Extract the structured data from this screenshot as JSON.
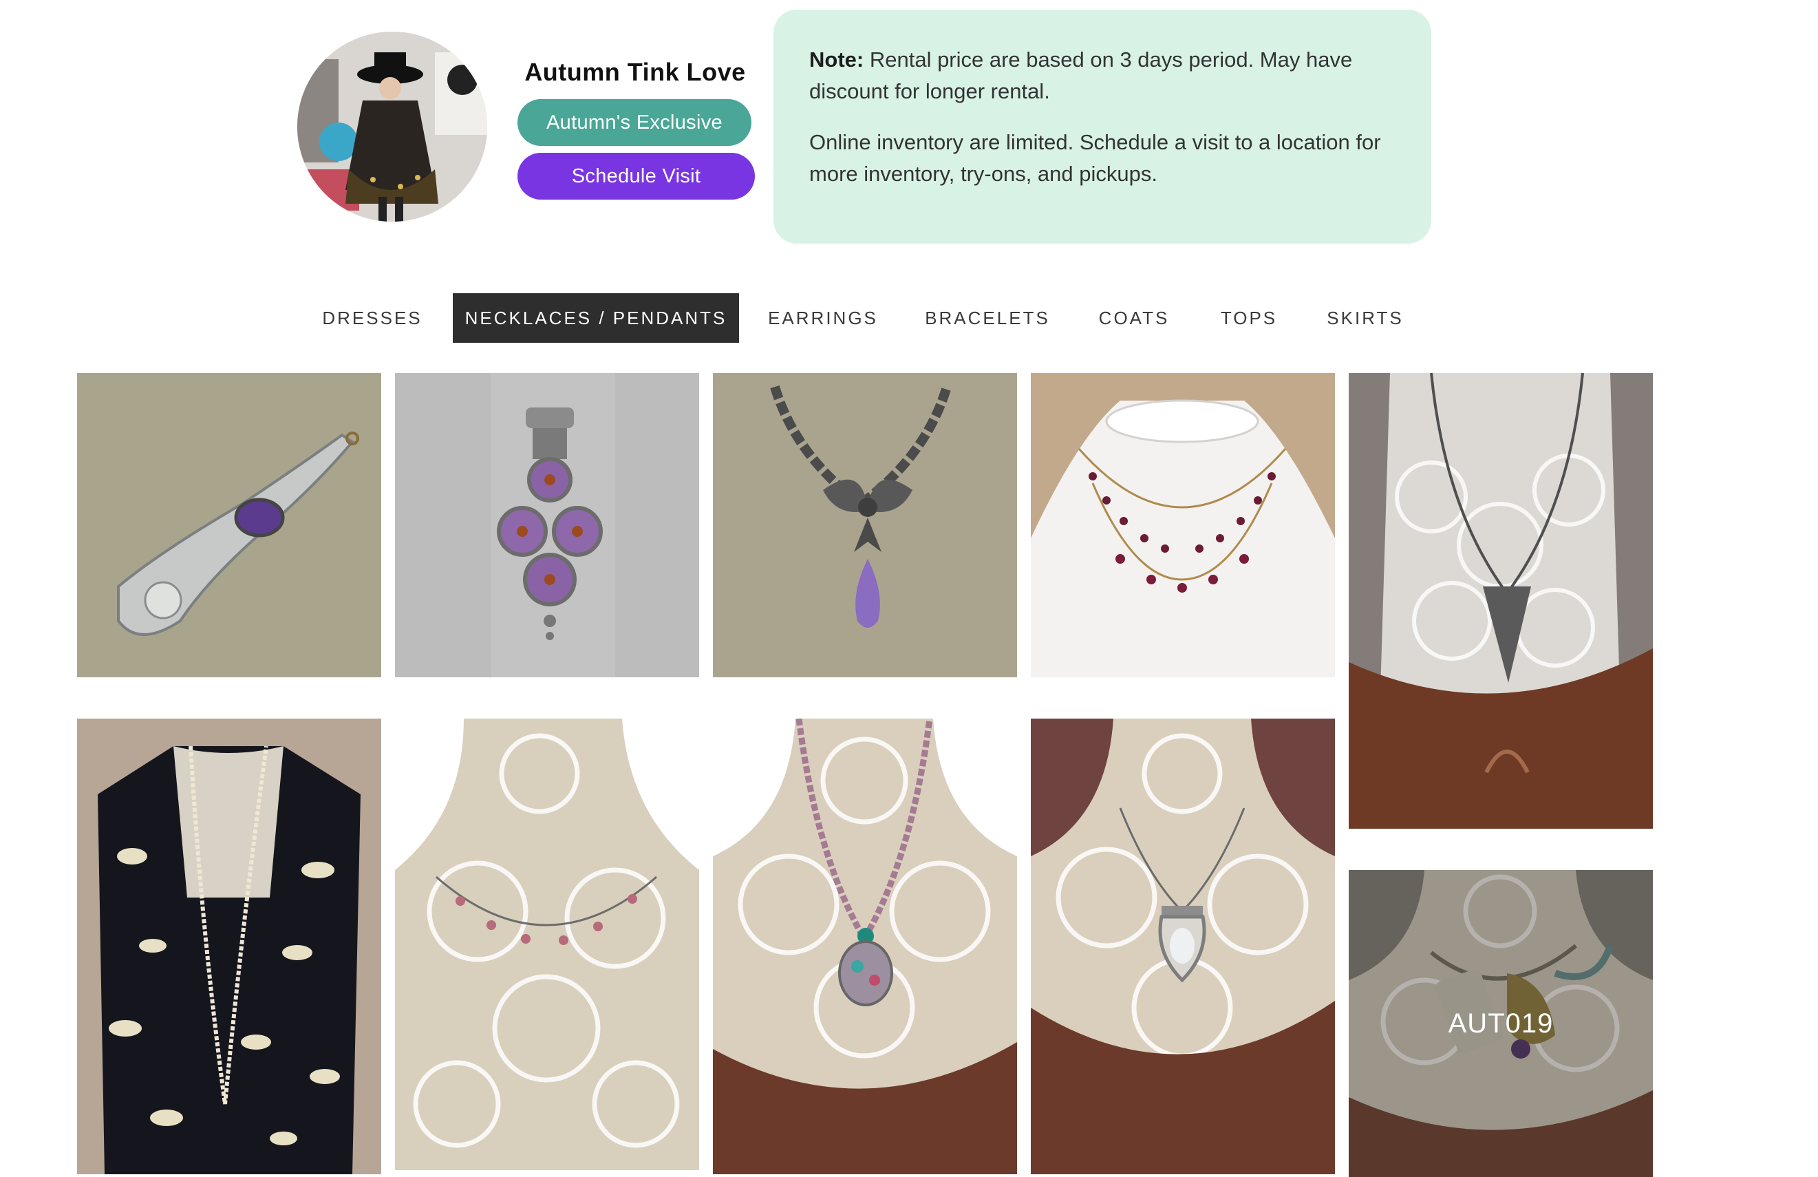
{
  "profile": {
    "name": "Autumn Tink Love",
    "exclusive_label": "Autumn's Exclusive",
    "schedule_label": "Schedule Visit"
  },
  "note": {
    "heading": "Note:",
    "line1": "Rental price are based on 3 days period. May have discount for longer rental.",
    "line2": "Online inventory are limited. Schedule a visit to a location for more inventory, try-ons, and pickups."
  },
  "tabs": [
    {
      "label": "DRESSES",
      "active": false
    },
    {
      "label": "NECKLACES / PENDANTS",
      "active": true
    },
    {
      "label": "EARRINGS",
      "active": false
    },
    {
      "label": "BRACELETS",
      "active": false
    },
    {
      "label": "COATS",
      "active": false
    },
    {
      "label": "TOPS",
      "active": false
    },
    {
      "label": "SKIRTS",
      "active": false
    }
  ],
  "products": {
    "hovered_sku": "AUT019"
  },
  "colors": {
    "accent_teal": "#4aa696",
    "accent_purple": "#7a35e2",
    "note_bg": "#d8f3e6",
    "active_tab_bg": "#2e2e2e"
  }
}
